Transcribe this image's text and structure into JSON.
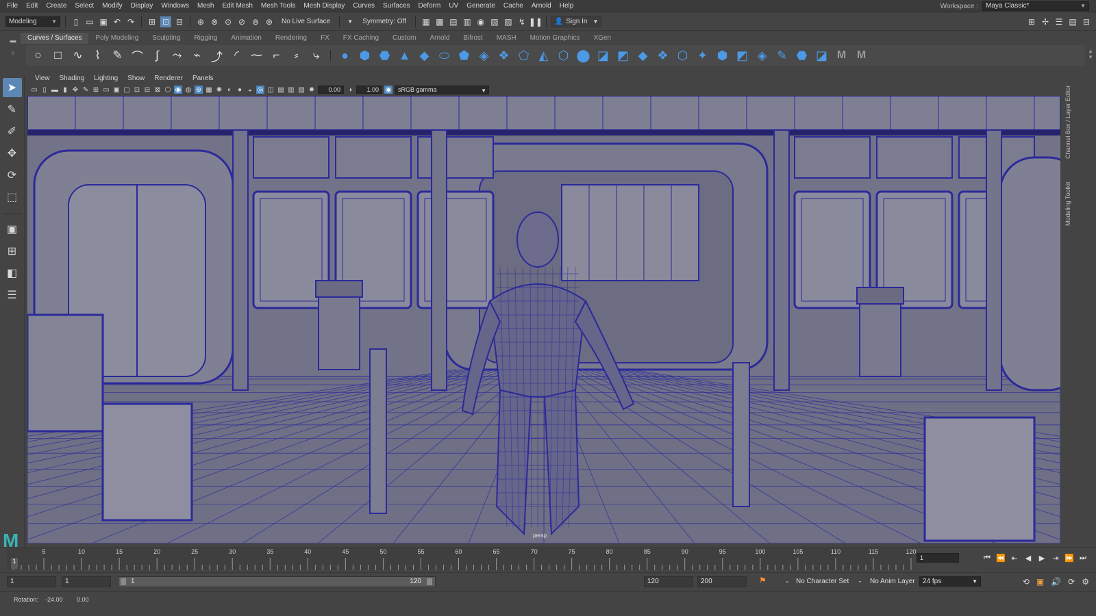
{
  "menubar": {
    "items": [
      "File",
      "Edit",
      "Create",
      "Select",
      "Modify",
      "Display",
      "Windows",
      "Mesh",
      "Edit Mesh",
      "Mesh Tools",
      "Mesh Display",
      "Curves",
      "Surfaces",
      "Deform",
      "UV",
      "Generate",
      "Cache",
      "Arnold",
      "Help"
    ],
    "workspace_label": "Workspace :",
    "workspace_value": "Maya Classic*"
  },
  "statusline": {
    "mode": "Modeling",
    "live_surface": "No Live Surface",
    "symmetry": "Symmetry: Off",
    "sign_in": "Sign In"
  },
  "shelf": {
    "tabs": [
      "Curves / Surfaces",
      "Poly Modeling",
      "Sculpting",
      "Rigging",
      "Animation",
      "Rendering",
      "FX",
      "FX Caching",
      "Custom",
      "Arnold",
      "Bifrost",
      "MASH",
      "Motion Graphics",
      "XGen"
    ],
    "active_tab": "Curves / Surfaces",
    "curve_icons": [
      "circle",
      "square",
      "cv-curve",
      "ep-curve",
      "pencil-curve",
      "arc",
      "bezier",
      "curve-tool",
      "curve-tool-2",
      "curve-tool-3",
      "arc-tool",
      "curve-tool-4",
      "curve-tool-5",
      "curve-tool-6",
      "curve-tool-7"
    ],
    "poly_icons": [
      "sphere",
      "cube",
      "cylinder",
      "cone",
      "plane",
      "torus",
      "nurbs-1",
      "nurbs-2",
      "nurbs-3",
      "nurbs-4",
      "nurbs-5",
      "nurbs-6",
      "nurbs-7",
      "nurbs-8",
      "nurbs-9",
      "nurbs-10",
      "nurbs-11",
      "nurbs-12",
      "nurbs-13",
      "nurbs-14",
      "nurbs-15",
      "nurbs-16",
      "nurbs-17",
      "nurbs-18",
      "nurbs-19"
    ],
    "mash_icons": [
      "M",
      "M"
    ]
  },
  "viewport": {
    "menu": [
      "View",
      "Shading",
      "Lighting",
      "Show",
      "Renderer",
      "Panels"
    ],
    "exposure": "0.00",
    "gamma": "1.00",
    "colorspace": "sRGB gamma",
    "camera": "persp",
    "bg_color": "#727389",
    "wire_color": "#2b2a9a"
  },
  "side_tabs": [
    "Channel Box / Layer Editor",
    "Modeling Toolkit"
  ],
  "timeslider": {
    "ticks": [
      5,
      10,
      15,
      20,
      25,
      30,
      35,
      40,
      45,
      50,
      55,
      60,
      65,
      70,
      75,
      80,
      85,
      90,
      95,
      100,
      105,
      110,
      115,
      120
    ],
    "min": 1,
    "max": 120,
    "current_time": "1",
    "current_frame_marker": "1"
  },
  "rangeslider": {
    "start_time": "1",
    "playback_start": "1",
    "range_start_label": "1",
    "range_end_label": "120",
    "playback_end": "120",
    "end_time": "200",
    "character_set": "No Character Set",
    "anim_layer": "No Anim Layer",
    "fps": "24 fps"
  },
  "helpline": {
    "label": "Rotation:",
    "value1": "-24.00",
    "value2": "0.00"
  }
}
